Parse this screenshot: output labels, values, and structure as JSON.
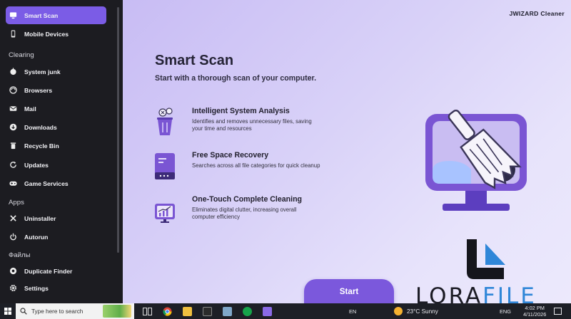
{
  "sidebar": {
    "items": [
      {
        "label": "Smart Scan",
        "icon": "monitor-icon",
        "active": true
      },
      {
        "label": "Mobile Devices",
        "icon": "phone-icon"
      }
    ],
    "sections": [
      {
        "title": "Clearing",
        "items": [
          {
            "label": "System junk",
            "icon": "broom-icon"
          },
          {
            "label": "Browsers",
            "icon": "globe-icon"
          },
          {
            "label": "Mail",
            "icon": "mail-icon"
          },
          {
            "label": "Downloads",
            "icon": "download-icon"
          },
          {
            "label": "Recycle Bin",
            "icon": "trash-icon"
          },
          {
            "label": "Updates",
            "icon": "refresh-icon"
          },
          {
            "label": "Game Services",
            "icon": "gamepad-icon"
          }
        ]
      },
      {
        "title": "Apps",
        "items": [
          {
            "label": "Uninstaller",
            "icon": "close-box-icon"
          },
          {
            "label": "Autorun",
            "icon": "power-icon"
          }
        ]
      },
      {
        "title": "Файлы",
        "items": [
          {
            "label": "Duplicate Finder",
            "icon": "duplicate-icon"
          },
          {
            "label": "Settings",
            "icon": "gear-icon"
          }
        ]
      }
    ]
  },
  "main": {
    "brand": "JWIZARD Cleaner",
    "title": "Smart Scan",
    "subtitle": "Start with a thorough scan of your computer.",
    "features": [
      {
        "title": "Intelligent System Analysis",
        "desc": "Identifies and removes unnecessary files, saving your time and resources",
        "icon": "trash-analysis-icon"
      },
      {
        "title": "Free Space Recovery",
        "desc": "Searches across all file categories for quick cleanup",
        "icon": "drive-icon"
      },
      {
        "title": "One-Touch Complete Cleaning",
        "desc": "Eliminates digital clutter, increasing overall computer efficiency",
        "icon": "performance-monitor-icon"
      }
    ],
    "start_label": "Start"
  },
  "watermark": {
    "text_dark": "LORA",
    "text_blue": "FILE"
  },
  "taskbar": {
    "search_placeholder": "Type here to search",
    "lang": "EN",
    "weather": "23°C  Sunny",
    "tray_lang": "ENG",
    "time": "4:02 PM",
    "date": "4/11/2026"
  },
  "colors": {
    "accent": "#7b5ce6",
    "sidebar_bg": "#1c1c21",
    "icon_purple": "#7a55d3"
  }
}
